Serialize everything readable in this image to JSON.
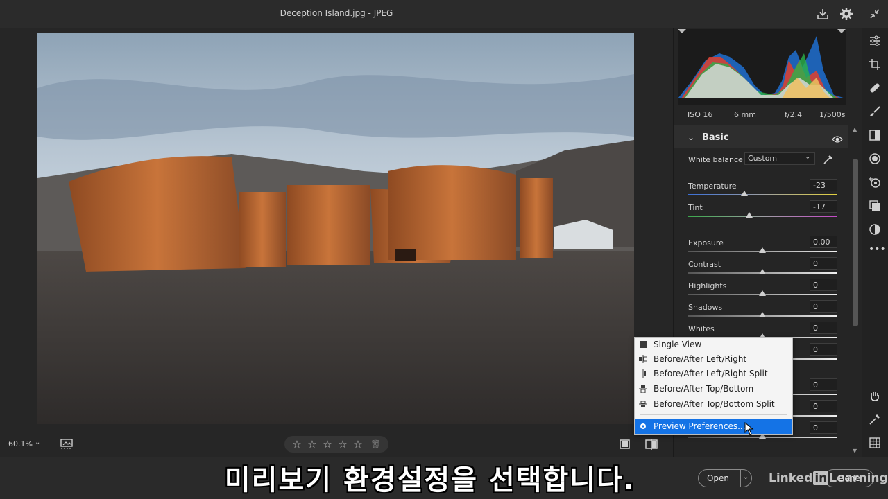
{
  "window": {
    "title": "Deception Island.jpg  -  JPEG"
  },
  "exif": {
    "iso": "ISO 16",
    "focal": "6 mm",
    "aperture": "f/2.4",
    "shutter": "1/500s"
  },
  "panel": {
    "section": "Basic",
    "white_balance": {
      "label": "White balance",
      "value": "Custom"
    },
    "sliders": [
      {
        "label": "Temperature",
        "value": "-23",
        "pos": 0.38
      },
      {
        "label": "Tint",
        "value": "-17",
        "pos": 0.41
      },
      {
        "label": "Exposure",
        "value": "0.00",
        "pos": 0.5
      },
      {
        "label": "Contrast",
        "value": "0",
        "pos": 0.5
      },
      {
        "label": "Highlights",
        "value": "0",
        "pos": 0.5
      },
      {
        "label": "Shadows",
        "value": "0",
        "pos": 0.5
      },
      {
        "label": "Whites",
        "value": "0",
        "pos": 0.5
      },
      {
        "label": "",
        "value": "0",
        "pos": 0.5
      },
      {
        "label": "",
        "value": "0",
        "pos": 0.5
      },
      {
        "label": "",
        "value": "0",
        "pos": 0.5
      },
      {
        "label": "",
        "value": "0",
        "pos": 0.5
      }
    ]
  },
  "bottom": {
    "zoom": "60.1%",
    "rating_stars": 5
  },
  "view_menu": {
    "items": [
      {
        "label": "Single View",
        "icon": "single-view-icon"
      },
      {
        "label": "Before/After Left/Right",
        "icon": "before-after-left-right-icon"
      },
      {
        "label": "Before/After Left/Right Split",
        "icon": "before-after-left-right-split-icon"
      },
      {
        "label": "Before/After Top/Bottom",
        "icon": "before-after-top-bottom-icon"
      },
      {
        "label": "Before/After Top/Bottom Split",
        "icon": "before-after-top-bottom-split-icon"
      }
    ],
    "preferences": "Preview Preferences..."
  },
  "footer": {
    "open_label": "Open",
    "done_label": "Done",
    "watermark_a": "Linked",
    "watermark_in": "in",
    "watermark_b": "Learning"
  },
  "caption": "미리보기 환경설정을 선택합니다.",
  "colors": {
    "accent": "#1473e6",
    "panel": "#252525",
    "menu_bg": "#f4f4f4"
  }
}
